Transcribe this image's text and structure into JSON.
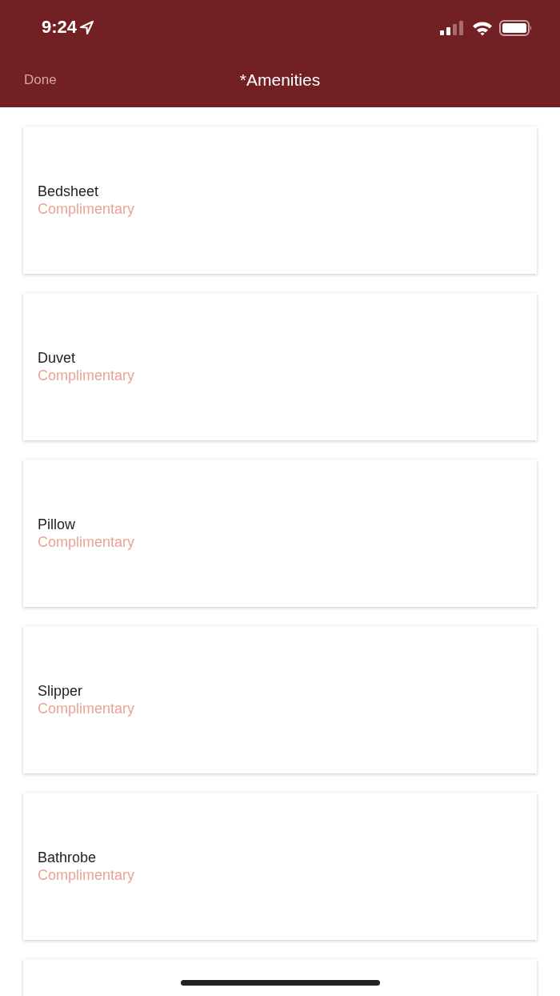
{
  "status_bar": {
    "time": "9:24"
  },
  "nav": {
    "back": "Done",
    "title": "*Amenities"
  },
  "items": [
    {
      "name": "Bedsheet",
      "price": "Complimentary"
    },
    {
      "name": "Duvet",
      "price": "Complimentary"
    },
    {
      "name": "Pillow",
      "price": "Complimentary"
    },
    {
      "name": "Slipper",
      "price": "Complimentary"
    },
    {
      "name": "Bathrobe",
      "price": "Complimentary"
    }
  ]
}
